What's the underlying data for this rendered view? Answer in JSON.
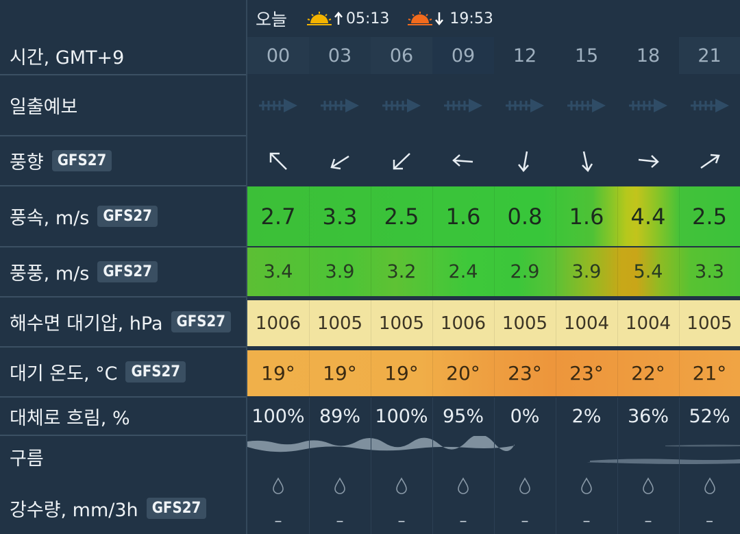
{
  "labels": {
    "time": "시간, GMT+9",
    "sunrise_forecast": "일출예보",
    "wind_dir": "풍향",
    "wind_speed": "풍속, m/s",
    "gust": "풍풍, m/s",
    "pressure": "해수면 대기압, hPa",
    "temperature": "대기 온도, °C",
    "cloud_cover": "대체로 흐림, %",
    "clouds": "구름",
    "precip": "강수량,  mm/3h",
    "model": "GFS27"
  },
  "top": {
    "day": "오늘",
    "sunrise": "05:13",
    "sunset": "19:53"
  },
  "hours": [
    "00",
    "03",
    "06",
    "09",
    "12",
    "15",
    "18",
    "21"
  ],
  "wind_dir_icons": [
    "arrow-up-left-icon",
    "arrow-down-left-icon",
    "arrow-down-left-icon",
    "arrow-left-icon",
    "arrow-down-icon",
    "arrow-down-icon",
    "arrow-right-icon",
    "arrow-up-right-icon"
  ],
  "wind_speed": [
    "2.7",
    "3.3",
    "2.5",
    "1.6",
    "0.8",
    "1.6",
    "4.4",
    "2.5"
  ],
  "gust": [
    "3.4",
    "3.9",
    "3.2",
    "2.4",
    "2.9",
    "3.9",
    "5.4",
    "3.3"
  ],
  "pressure": [
    "1006",
    "1005",
    "1005",
    "1006",
    "1005",
    "1004",
    "1004",
    "1005"
  ],
  "temperature": [
    "19°",
    "19°",
    "19°",
    "20°",
    "23°",
    "23°",
    "22°",
    "21°"
  ],
  "cloud_cover": [
    "100%",
    "89%",
    "100%",
    "95%",
    "0%",
    "2%",
    "36%",
    "52%"
  ],
  "precip": [
    "–",
    "–",
    "–",
    "–",
    "–",
    "–",
    "–",
    "–"
  ],
  "colors": {
    "background": "#213345",
    "wind_green": "#3cc23a",
    "wind_yellow": "#b7c21e",
    "pressure_yellow": "#f3e4a1",
    "temp_orange": "#f0a646"
  }
}
